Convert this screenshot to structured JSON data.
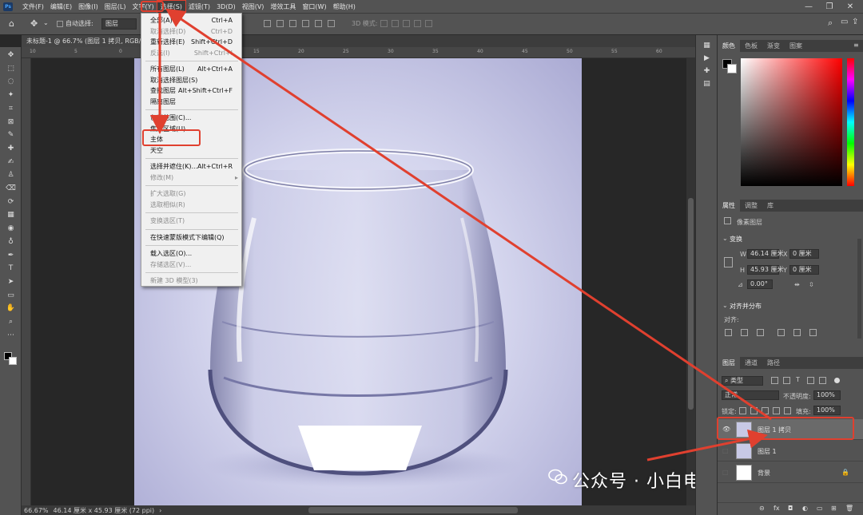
{
  "menubar": {
    "logo": "Ps",
    "items": [
      "文件(F)",
      "编辑(E)",
      "图像(I)",
      "图层(L)",
      "文字(Y)",
      "选择(S)",
      "滤镜(T)",
      "3D(D)",
      "视图(V)",
      "增效工具",
      "窗口(W)",
      "帮助(H)"
    ],
    "active_index": 5,
    "window_controls": [
      "—",
      "❐",
      "✕"
    ]
  },
  "options": {
    "home_icon": "⌂",
    "move_icon": "✥",
    "auto_select_label": "自动选择:",
    "layer_select_value": "图层",
    "mode_3d_label": "3D 模式:",
    "search_icon": "⌕",
    "workspace_icon": "▭",
    "share_icon": "⇪"
  },
  "document": {
    "tab_title": "未标题-1 @ 66.7% (图层 1 拷贝, RGB/8#)",
    "tab_close": "×"
  },
  "ruler_ticks": [
    "10",
    "5",
    "0",
    "5",
    "10",
    "15",
    "20",
    "25",
    "30",
    "35",
    "40",
    "45",
    "50",
    "55",
    "60"
  ],
  "status": {
    "zoom": "66.67%",
    "doc_size": "46.14 厘米 x 45.93 厘米 (72 ppi)",
    "arrow": "›"
  },
  "select_menu": {
    "items": [
      {
        "label": "全部(A)",
        "shortcut": "Ctrl+A",
        "disabled": false
      },
      {
        "label": "取消选择(D)",
        "shortcut": "Ctrl+D",
        "disabled": true
      },
      {
        "label": "重新选择(E)",
        "shortcut": "Shift+Ctrl+D",
        "disabled": false
      },
      {
        "label": "反选(I)",
        "shortcut": "Shift+Ctrl+I",
        "disabled": true
      },
      {
        "sep": true
      },
      {
        "label": "所有图层(L)",
        "shortcut": "Alt+Ctrl+A",
        "disabled": false
      },
      {
        "label": "取消选择图层(S)",
        "shortcut": "",
        "disabled": false
      },
      {
        "label": "查找图层",
        "shortcut": "Alt+Shift+Ctrl+F",
        "disabled": false
      },
      {
        "label": "隔离图层",
        "shortcut": "",
        "disabled": false
      },
      {
        "sep": true
      },
      {
        "label": "色彩范围(C)...",
        "shortcut": "",
        "disabled": false
      },
      {
        "label": "焦点区域(U)...",
        "shortcut": "",
        "disabled": false
      },
      {
        "label": "主体",
        "shortcut": "",
        "disabled": false
      },
      {
        "label": "天空",
        "shortcut": "",
        "disabled": false
      },
      {
        "sep": true
      },
      {
        "label": "选择并遮住(K)...",
        "shortcut": "Alt+Ctrl+R",
        "disabled": false
      },
      {
        "label": "修改(M)",
        "shortcut": "",
        "disabled": true,
        "submenu": true
      },
      {
        "sep": true
      },
      {
        "label": "扩大选取(G)",
        "shortcut": "",
        "disabled": true
      },
      {
        "label": "选取相似(R)",
        "shortcut": "",
        "disabled": true
      },
      {
        "sep": true
      },
      {
        "label": "变换选区(T)",
        "shortcut": "",
        "disabled": true
      },
      {
        "sep": true
      },
      {
        "label": "在快速蒙版模式下编辑(Q)",
        "shortcut": "",
        "disabled": false
      },
      {
        "sep": true
      },
      {
        "label": "载入选区(O)...",
        "shortcut": "",
        "disabled": false
      },
      {
        "label": "存储选区(V)...",
        "shortcut": "",
        "disabled": true
      },
      {
        "sep": true
      },
      {
        "label": "新建 3D 模型(3)",
        "shortcut": "",
        "disabled": true
      }
    ],
    "submenu_arrow": "▸"
  },
  "tools": [
    "✥",
    "⬚",
    "◌",
    "✦",
    "⌗",
    "⊠",
    "✎",
    "✚",
    "✍",
    "♙",
    "⌫",
    "⟳",
    "▦",
    "◉",
    "♁",
    "✒",
    "T",
    "➤",
    "▭",
    "✋",
    "⌕",
    "⋯"
  ],
  "mini_panel": [
    "▦",
    "▶",
    "✚",
    "▤"
  ],
  "color_panel": {
    "tabs": [
      "颜色",
      "色板",
      "渐变",
      "图案"
    ],
    "active_tab": 0,
    "menu_icon": "≡",
    "collapse_icon": "»"
  },
  "properties_panel": {
    "tabs": [
      "属性",
      "调整",
      "库"
    ],
    "active_tab": 0,
    "pixel_layer_label": "像素图层",
    "transform_title": "变换",
    "w_label": "W",
    "w_value": "46.14 厘米",
    "x_label": "X",
    "x_value": "0 厘米",
    "h_label": "H",
    "h_value": "45.93 厘米",
    "y_label": "Y",
    "y_value": "0 厘米",
    "angle_value": "0.00°",
    "align_title": "对齐并分布",
    "align_label": "对齐:"
  },
  "layers_panel": {
    "tabs": [
      "图层",
      "通道",
      "路径"
    ],
    "active_tab": 0,
    "kind_label": "类型",
    "blend_mode": "正常",
    "opacity_label": "不透明度:",
    "opacity_value": "100%",
    "lock_label": "锁定:",
    "fill_label": "填充:",
    "fill_value": "100%",
    "layers": [
      {
        "name": "图层 1 拷贝",
        "visible": true,
        "selected": true
      },
      {
        "name": "图层 1",
        "visible": false,
        "selected": false
      },
      {
        "name": "背景",
        "visible": false,
        "selected": false,
        "locked": true
      }
    ],
    "footer_icons": [
      "⊝",
      "fx",
      "◘",
      "◐",
      "▭",
      "⊞",
      "🗑"
    ]
  },
  "watermark": "公众号 · 小白电脑技术",
  "accent_red": "#e0402f"
}
